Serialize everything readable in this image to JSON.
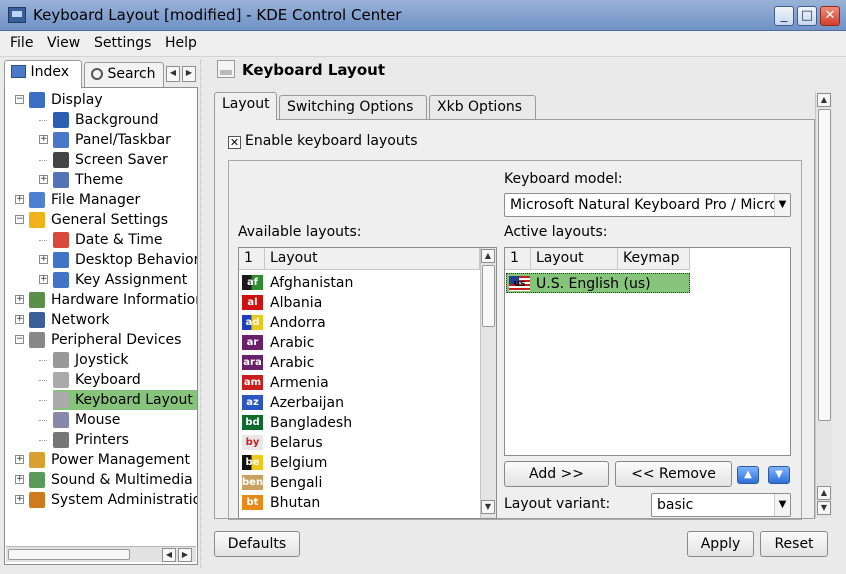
{
  "window": {
    "title": "Keyboard Layout [modified] - KDE Control Center",
    "controls": {
      "minimize": "_",
      "maximize": "□",
      "close": "✕"
    }
  },
  "menubar": {
    "items": [
      {
        "label": "File"
      },
      {
        "label": "View"
      },
      {
        "label": "Settings"
      },
      {
        "label": "Help"
      }
    ]
  },
  "sidebar": {
    "tabs": [
      {
        "label": "Index",
        "icon": "index-icon",
        "active": true
      },
      {
        "label": "Search",
        "icon": "search-icon",
        "active": false
      }
    ],
    "tree": [
      {
        "label": "Display",
        "level": 0,
        "expander": "−",
        "icon": "display-icon",
        "color": "#3b6fc4"
      },
      {
        "label": "Background",
        "level": 1,
        "expander": "",
        "icon": "background-icon",
        "color": "#2b5fb4"
      },
      {
        "label": "Panel/Taskbar",
        "level": 1,
        "expander": "+",
        "icon": "panel-icon",
        "color": "#4a78c8"
      },
      {
        "label": "Screen Saver",
        "level": 1,
        "expander": "",
        "icon": "screensaver-icon",
        "color": "#444444"
      },
      {
        "label": "Theme",
        "level": 1,
        "expander": "+",
        "icon": "theme-icon",
        "color": "#5574b8"
      },
      {
        "label": "File Manager",
        "level": 0,
        "expander": "+",
        "icon": "file-manager-icon",
        "color": "#4f7fd0"
      },
      {
        "label": "General Settings",
        "level": 0,
        "expander": "−",
        "icon": "star-icon",
        "color": "#f2b21b"
      },
      {
        "label": "Date & Time",
        "level": 1,
        "expander": "",
        "icon": "calendar-icon",
        "color": "#d84a3a"
      },
      {
        "label": "Desktop Behavior",
        "level": 1,
        "expander": "+",
        "icon": "desktop-icon",
        "color": "#3f74c6"
      },
      {
        "label": "Key Assignment",
        "level": 1,
        "expander": "+",
        "icon": "key-icon",
        "color": "#3f74c6"
      },
      {
        "label": "Hardware Information",
        "level": 0,
        "expander": "+",
        "icon": "hardware-icon",
        "color": "#5a8f4a"
      },
      {
        "label": "Network",
        "level": 0,
        "expander": "+",
        "icon": "network-icon",
        "color": "#3c5f9a"
      },
      {
        "label": "Peripheral Devices",
        "level": 0,
        "expander": "−",
        "icon": "peripheral-icon",
        "color": "#888888"
      },
      {
        "label": "Joystick",
        "level": 1,
        "expander": "",
        "icon": "joystick-icon",
        "color": "#999999"
      },
      {
        "label": "Keyboard",
        "level": 1,
        "expander": "",
        "icon": "keyboard-icon",
        "color": "#aaaaaa"
      },
      {
        "label": "Keyboard Layout",
        "level": 1,
        "expander": "",
        "icon": "keyboard-layout-icon",
        "color": "#aaaaaa",
        "selected": true
      },
      {
        "label": "Mouse",
        "level": 1,
        "expander": "",
        "icon": "mouse-icon",
        "color": "#8888aa"
      },
      {
        "label": "Printers",
        "level": 1,
        "expander": "",
        "icon": "printer-icon",
        "color": "#777777"
      },
      {
        "label": "Power Management",
        "level": 0,
        "expander": "+",
        "icon": "power-icon",
        "color": "#d8a030"
      },
      {
        "label": "Sound & Multimedia",
        "level": 0,
        "expander": "+",
        "icon": "sound-icon",
        "color": "#5a9a5a"
      },
      {
        "label": "System Administration",
        "level": 0,
        "expander": "+",
        "icon": "admin-icon",
        "color": "#d07a20"
      }
    ]
  },
  "main": {
    "page_title": "Keyboard Layout",
    "tabs": [
      {
        "label": "Layout",
        "active": true
      },
      {
        "label": "Switching Options",
        "active": false
      },
      {
        "label": "Xkb Options",
        "active": false
      }
    ],
    "enable_checkbox": {
      "label": "Enable keyboard layouts",
      "checked": true,
      "mark": "✕"
    },
    "keyboard_model": {
      "label": "Keyboard model:",
      "value": "Microsoft Natural Keyboard Pro / Microsoft Internet Keyboard Pro"
    },
    "available": {
      "label": "Available layouts:",
      "columns": [
        "1",
        "Layout"
      ],
      "rows": [
        {
          "flag": "af",
          "name": "Afghanistan",
          "bg": "#1a1a1a",
          "fg": "#ffffff",
          "stripe": "#2e8b2e"
        },
        {
          "flag": "al",
          "name": "Albania",
          "bg": "#cc1111",
          "fg": "#ffffff",
          "stripe": ""
        },
        {
          "flag": "ad",
          "name": "Andorra",
          "bg": "#1f3fb8",
          "fg": "#ffffff",
          "stripe": "#e8c81a"
        },
        {
          "flag": "ar",
          "name": "Arabic",
          "bg": "#6a1f6a",
          "fg": "#ffffff",
          "stripe": ""
        },
        {
          "flag": "ara",
          "name": "Arabic",
          "bg": "#6a1f6a",
          "fg": "#ffffff",
          "stripe": ""
        },
        {
          "flag": "am",
          "name": "Armenia",
          "bg": "#c81e1e",
          "fg": "#ffffff",
          "stripe": ""
        },
        {
          "flag": "az",
          "name": "Azerbaijan",
          "bg": "#2a56c0",
          "fg": "#ffffff",
          "stripe": ""
        },
        {
          "flag": "bd",
          "name": "Bangladesh",
          "bg": "#0f6a2e",
          "fg": "#ffffff",
          "stripe": ""
        },
        {
          "flag": "by",
          "name": "Belarus",
          "bg": "#e8e8e8",
          "fg": "#c81e1e",
          "stripe": ""
        },
        {
          "flag": "be",
          "name": "Belgium",
          "bg": "#111111",
          "fg": "#ffffff",
          "stripe": "#f0c81a"
        },
        {
          "flag": "ben",
          "name": "Bengali",
          "bg": "#c8a060",
          "fg": "#ffffff",
          "stripe": ""
        },
        {
          "flag": "bt",
          "name": "Bhutan",
          "bg": "#e88a1a",
          "fg": "#ffffff",
          "stripe": ""
        }
      ]
    },
    "active": {
      "label": "Active layouts:",
      "columns": [
        "1",
        "Layout",
        "Keymap"
      ],
      "rows": [
        {
          "flag": "us",
          "name": "U.S. English (us)",
          "selected": true
        }
      ]
    },
    "buttons": {
      "add": "Add >>",
      "remove": "<< Remove",
      "move_up": "▲",
      "move_down": "▼"
    },
    "layout_variant": {
      "label": "Layout variant:",
      "value": "basic"
    }
  },
  "footer": {
    "defaults": "Defaults",
    "apply": "Apply",
    "reset": "Reset"
  },
  "scroll_arrows": {
    "up": "▲",
    "down": "▼",
    "left": "◀",
    "right": "▶",
    "tab_left": "◀",
    "tab_right": "▶"
  },
  "colors": {
    "selection": "#87c47b",
    "titlebar": "#7f9fcf"
  }
}
